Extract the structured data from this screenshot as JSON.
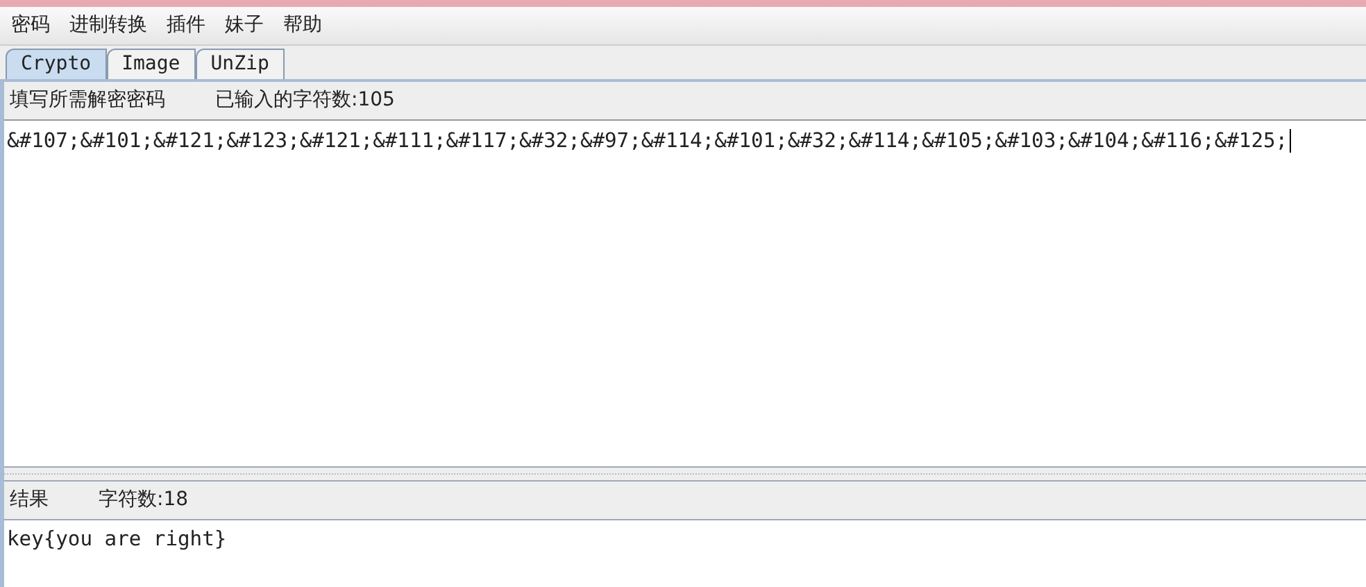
{
  "menu": [
    "密码",
    "进制转换",
    "插件",
    "妹子",
    "帮助"
  ],
  "tabs": [
    {
      "label": "Crypto",
      "selected": true
    },
    {
      "label": "Image",
      "selected": false
    },
    {
      "label": "UnZip",
      "selected": false
    }
  ],
  "input_panel": {
    "label": "填写所需解密密码",
    "count": "已输入的字符数:105",
    "value": "&#107;&#101;&#121;&#123;&#121;&#111;&#117;&#32;&#97;&#114;&#101;&#32;&#114;&#105;&#103;&#104;&#116;&#125;"
  },
  "output_panel": {
    "label": "结果",
    "count": "字符数:18",
    "value": "key{you are right}"
  }
}
